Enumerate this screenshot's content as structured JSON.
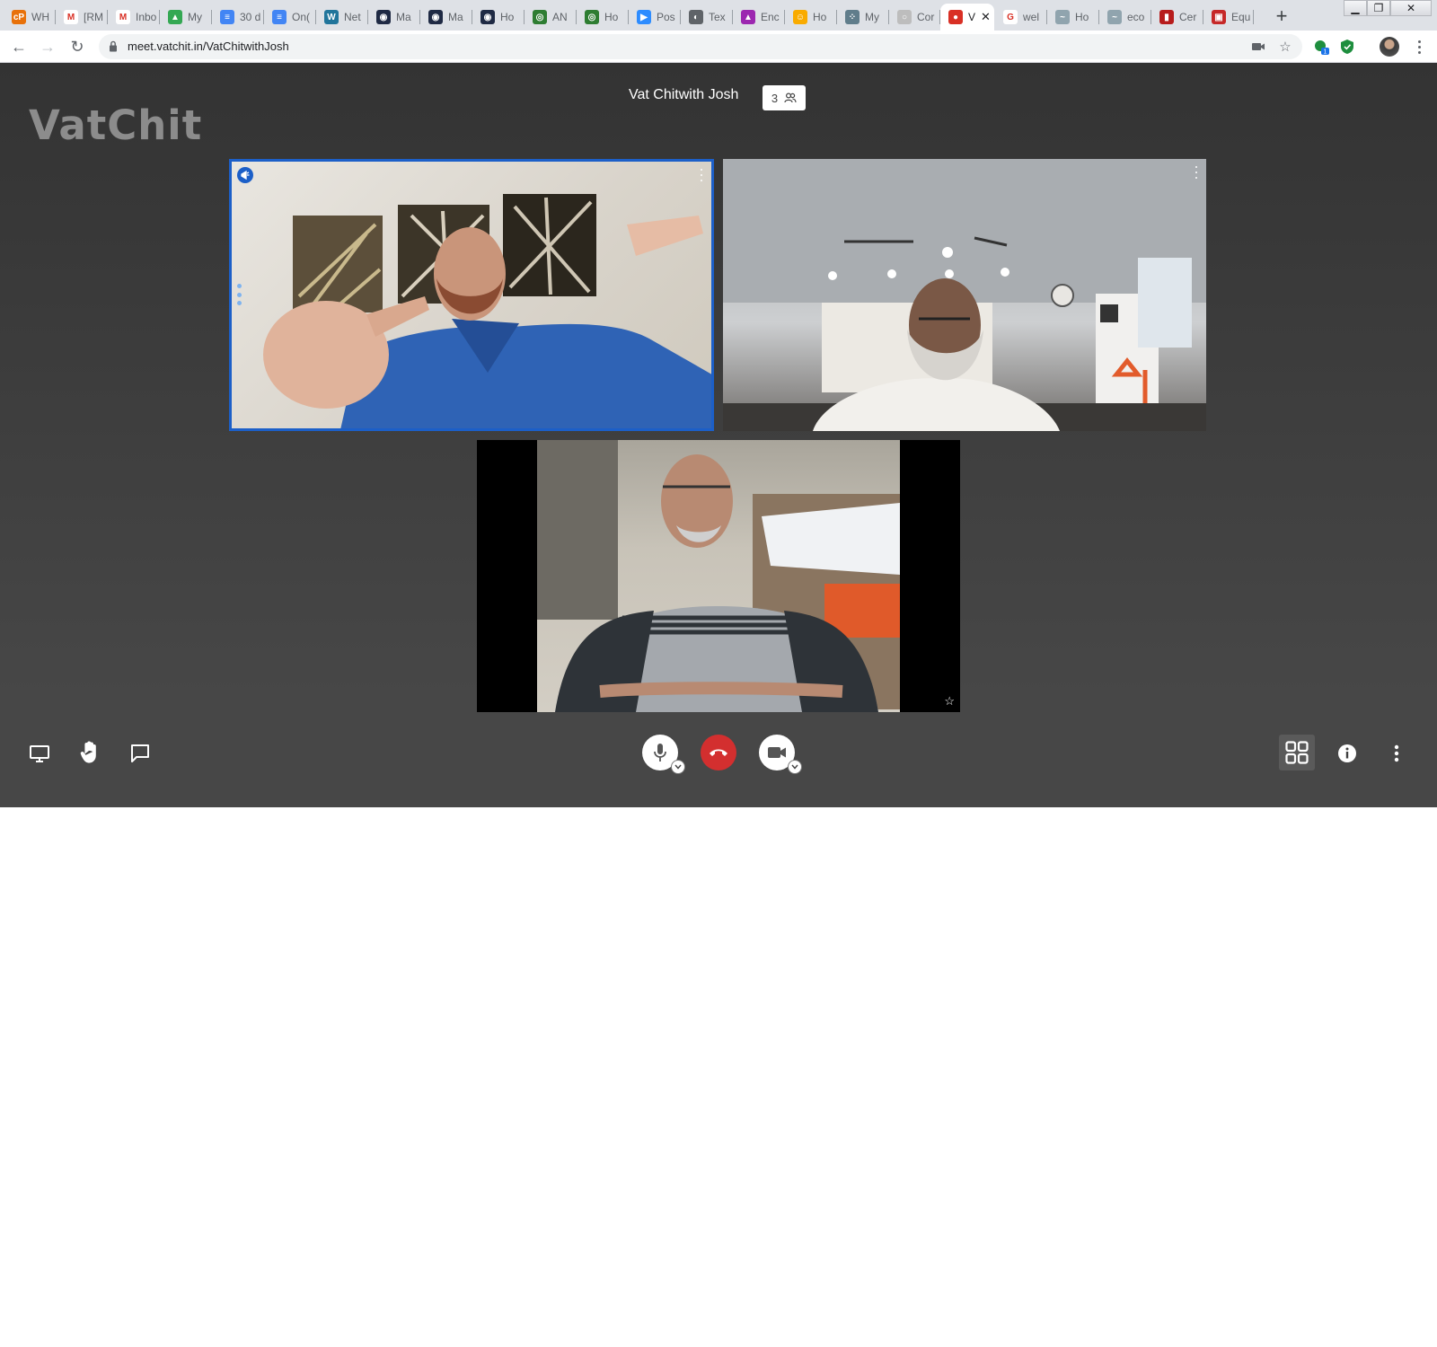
{
  "browser": {
    "tabs": [
      {
        "label": "WH",
        "fav_color": "#e8710a",
        "fav_char": "cP"
      },
      {
        "label": "[RM",
        "fav_color": "#ffffff",
        "fav_char": "M"
      },
      {
        "label": "Inbo",
        "fav_color": "#ffffff",
        "fav_char": "M"
      },
      {
        "label": "My",
        "fav_color": "#34a853",
        "fav_char": "▲"
      },
      {
        "label": "30 d",
        "fav_color": "#4285f4",
        "fav_char": "≡"
      },
      {
        "label": "On(",
        "fav_color": "#4285f4",
        "fav_char": "≡"
      },
      {
        "label": "Net",
        "fav_color": "#21759b",
        "fav_char": "W"
      },
      {
        "label": "Ma",
        "fav_color": "#1f2a44",
        "fav_char": "◉"
      },
      {
        "label": "Ma",
        "fav_color": "#1f2a44",
        "fav_char": "◉"
      },
      {
        "label": "Ho",
        "fav_color": "#1f2a44",
        "fav_char": "◉"
      },
      {
        "label": "AN",
        "fav_color": "#2e7d32",
        "fav_char": "◎"
      },
      {
        "label": "Ho",
        "fav_color": "#2e7d32",
        "fav_char": "◎"
      },
      {
        "label": "Pos",
        "fav_color": "#2d8cff",
        "fav_char": "▶"
      },
      {
        "label": "Tex",
        "fav_color": "#5f6368",
        "fav_char": "◐"
      },
      {
        "label": "Enc",
        "fav_color": "#9c27b0",
        "fav_char": "▲"
      },
      {
        "label": "Ho",
        "fav_color": "#f9ab00",
        "fav_char": "☺"
      },
      {
        "label": "My",
        "fav_color": "#607d8b",
        "fav_char": "⁘"
      },
      {
        "label": "Cor",
        "fav_color": "#bdbdbd",
        "fav_char": "○"
      },
      {
        "label": "V",
        "fav_color": "#d93025",
        "fav_char": "●",
        "active": true
      },
      {
        "label": "wel",
        "fav_color": "#ffffff",
        "fav_char": "G"
      },
      {
        "label": "Ho",
        "fav_color": "#90a4ae",
        "fav_char": "~"
      },
      {
        "label": "eco",
        "fav_color": "#90a4ae",
        "fav_char": "~"
      },
      {
        "label": "Cer",
        "fav_color": "#b71c1c",
        "fav_char": "▮"
      },
      {
        "label": "Equ",
        "fav_color": "#c62828",
        "fav_char": "▣"
      }
    ],
    "url": "meet.vatchit.in/VatChitwithJosh"
  },
  "meeting": {
    "logo": "VatChit",
    "title": "Vat Chitwith Josh",
    "participant_count": "3"
  },
  "colors": {
    "accent": "#1c5fc8",
    "hangup": "#d32f2f",
    "background": "#3d3d3d"
  },
  "icons": {
    "toolbar_left": [
      "screen-share-icon",
      "raise-hand-icon",
      "chat-icon"
    ],
    "toolbar_center": [
      "microphone-icon",
      "hangup-icon",
      "camera-icon"
    ],
    "toolbar_right": [
      "tile-view-icon",
      "info-icon",
      "more-options-icon"
    ]
  }
}
